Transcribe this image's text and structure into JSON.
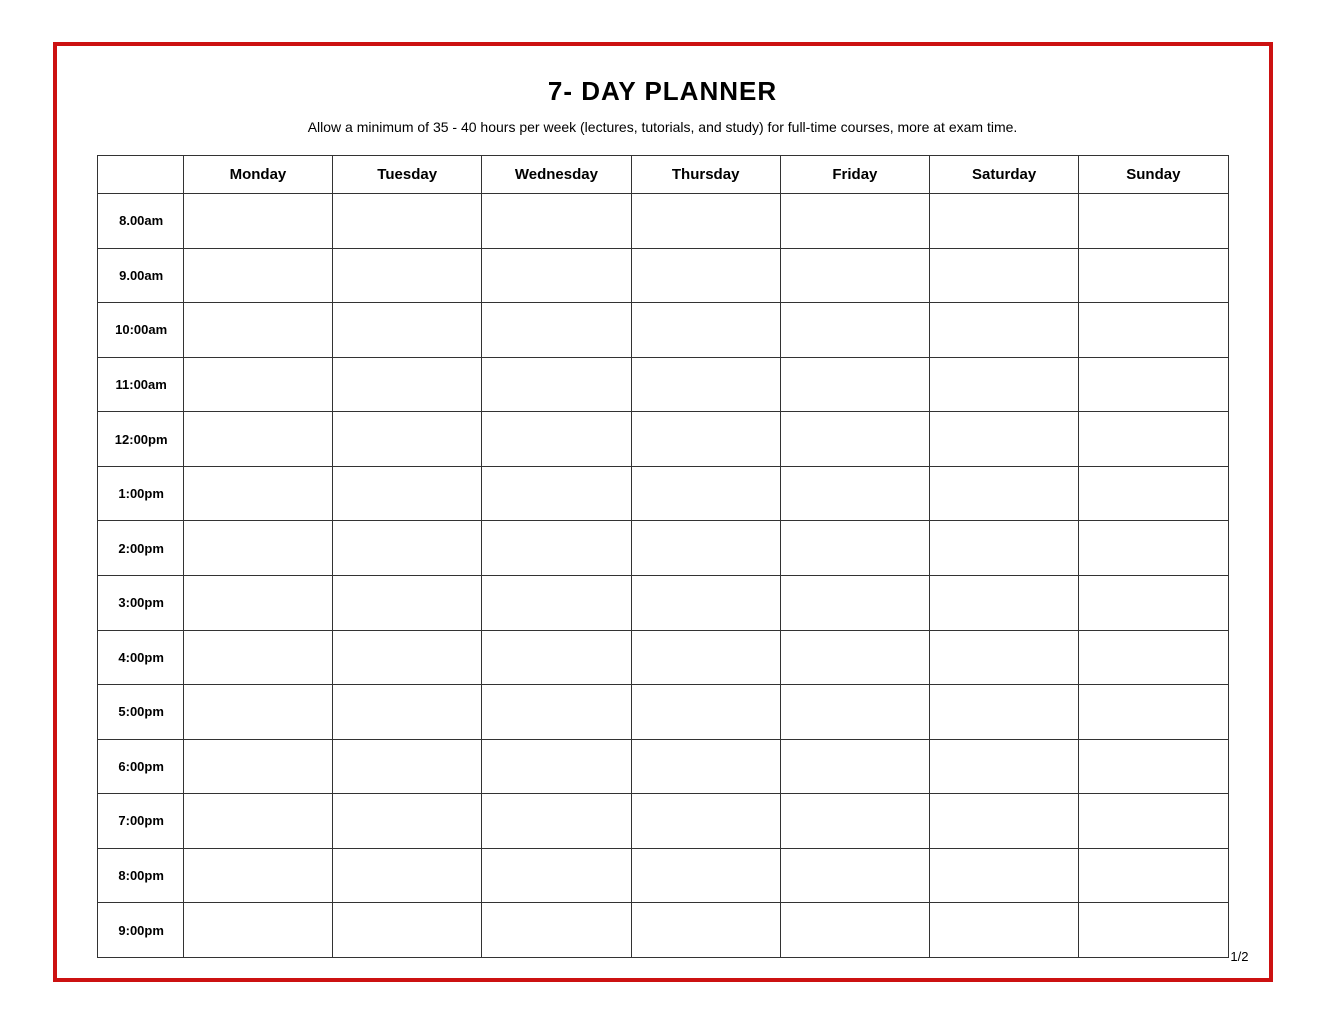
{
  "title": "7- DAY PLANNER",
  "subtitle": "Allow a minimum of 35 - 40 hours per week (lectures, tutorials, and study) for full-time courses, more at exam time.",
  "page_number": "1/2",
  "columns": [
    "",
    "Monday",
    "Tuesday",
    "Wednesday",
    "Thursday",
    "Friday",
    "Saturday",
    "Sunday"
  ],
  "time_slots": [
    "8.00am",
    "9.00am",
    "10:00am",
    "11:00am",
    "12:00pm",
    "1:00pm",
    "2:00pm",
    "3:00pm",
    "4:00pm",
    "5:00pm",
    "6:00pm",
    "7:00pm",
    "8:00pm",
    "9:00pm"
  ]
}
